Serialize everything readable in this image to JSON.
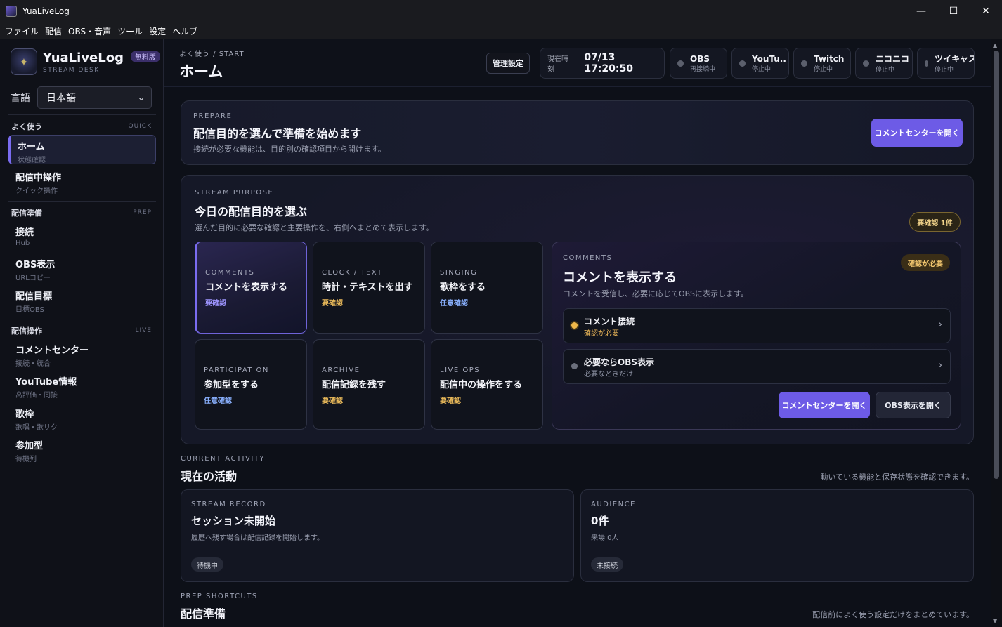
{
  "window": {
    "title": "YuaLiveLog",
    "controls": {
      "minimize": "—",
      "maximize": "☐",
      "close": "✕"
    }
  },
  "menu": [
    "ファイル",
    "配信",
    "OBS・音声",
    "ツール",
    "設定",
    "ヘルプ"
  ],
  "sidebar": {
    "brand": {
      "name": "YuaLiveLog",
      "badge": "無料版",
      "subtitle": "STREAM DESK"
    },
    "language": {
      "label": "言語",
      "value": "日本語"
    },
    "groups": [
      {
        "title": "よく使う",
        "tag": "QUICK",
        "items": [
          {
            "label": "ホーム",
            "sub": "状態確認",
            "active": true
          },
          {
            "label": "配信中操作",
            "sub": "クイック操作"
          }
        ]
      },
      {
        "title": "配信準備",
        "tag": "PREP",
        "items": [
          {
            "label": "接続",
            "sub": "Hub"
          },
          {
            "label": "OBS表示",
            "sub": "URLコピー"
          },
          {
            "label": "配信目標",
            "sub": "目標OBS"
          }
        ]
      },
      {
        "title": "配信操作",
        "tag": "LIVE",
        "items": [
          {
            "label": "コメントセンター",
            "sub": "接続・統合"
          },
          {
            "label": "YouTube情報",
            "sub": "高評価・同接"
          },
          {
            "label": "歌枠",
            "sub": "歌唱・歌リク"
          },
          {
            "label": "参加型",
            "sub": "待機列"
          }
        ]
      }
    ]
  },
  "header": {
    "breadcrumb": "よく使う / START",
    "title": "ホーム",
    "admin_button": "管理設定",
    "clock": {
      "label": "現在時刻",
      "value": "07/13 17:20:50"
    },
    "statuses": [
      {
        "name": "OBS",
        "state": "再接続中"
      },
      {
        "name": "YouTu...",
        "state": "停止中"
      },
      {
        "name": "Twitch",
        "state": "停止中"
      },
      {
        "name": "ニコニコ",
        "state": "停止中"
      },
      {
        "name": "ツイキャス",
        "state": "停止中"
      }
    ]
  },
  "prepare": {
    "eyebrow": "PREPARE",
    "title": "配信目的を選んで準備を始めます",
    "desc": "接続が必要な機能は、目的別の確認項目から開けます。",
    "button": "コメントセンターを開く"
  },
  "purpose": {
    "eyebrow": "STREAM PURPOSE",
    "title": "今日の配信目的を選ぶ",
    "desc": "選んだ目的に必要な確認と主要操作を、右側へまとめて表示します。",
    "badge": "要確認 1件",
    "cards": [
      {
        "eyebrow": "COMMENTS",
        "title": "コメントを表示する",
        "status": "要確認",
        "kind": "warn",
        "selected": true
      },
      {
        "eyebrow": "CLOCK / TEXT",
        "title": "時計・テキストを出す",
        "status": "要確認",
        "kind": "warn"
      },
      {
        "eyebrow": "SINGING",
        "title": "歌枠をする",
        "status": "任意確認",
        "kind": "info"
      },
      {
        "eyebrow": "PARTICIPATION",
        "title": "参加型をする",
        "status": "任意確認",
        "kind": "info"
      },
      {
        "eyebrow": "ARCHIVE",
        "title": "配信記録を残す",
        "status": "要確認",
        "kind": "warn"
      },
      {
        "eyebrow": "LIVE OPS",
        "title": "配信中の操作をする",
        "status": "要確認",
        "kind": "warn"
      }
    ],
    "detail": {
      "eyebrow": "COMMENTS",
      "title": "コメントを表示する",
      "desc": "コメントを受信し、必要に応じてOBSに表示します。",
      "badge": "確認が必要",
      "checks": [
        {
          "title": "コメント接続",
          "sub": "確認が必要",
          "dot_color": "#f0b84a",
          "sub_color": "#e8b457"
        },
        {
          "title": "必要ならOBS表示",
          "sub": "必要なときだけ",
          "dot_color": "#6b6f7c",
          "sub_color": "#8a8fa0"
        }
      ],
      "arrow": "›",
      "primary_button": "コメントセンターを開く",
      "secondary_button": "OBS表示を開く"
    }
  },
  "activity": {
    "eyebrow": "CURRENT ACTIVITY",
    "title": "現在の活動",
    "note": "動いている機能と保存状態を確認できます。",
    "cards": [
      {
        "eyebrow": "STREAM RECORD",
        "title": "セッション未開始",
        "desc": "履歴へ残す場合は配信記録を開始します。",
        "pill": "待機中"
      },
      {
        "eyebrow": "AUDIENCE",
        "title": "0件",
        "desc": "来場 0人",
        "pill": "未接続"
      }
    ]
  },
  "shortcuts": {
    "eyebrow": "PREP SHORTCUTS",
    "title": "配信準備",
    "note": "配信前によく使う設定だけをまとめています。"
  },
  "icons": {
    "select_arrow": "⌄",
    "scroll_up": "▲",
    "scroll_down": "▼"
  }
}
